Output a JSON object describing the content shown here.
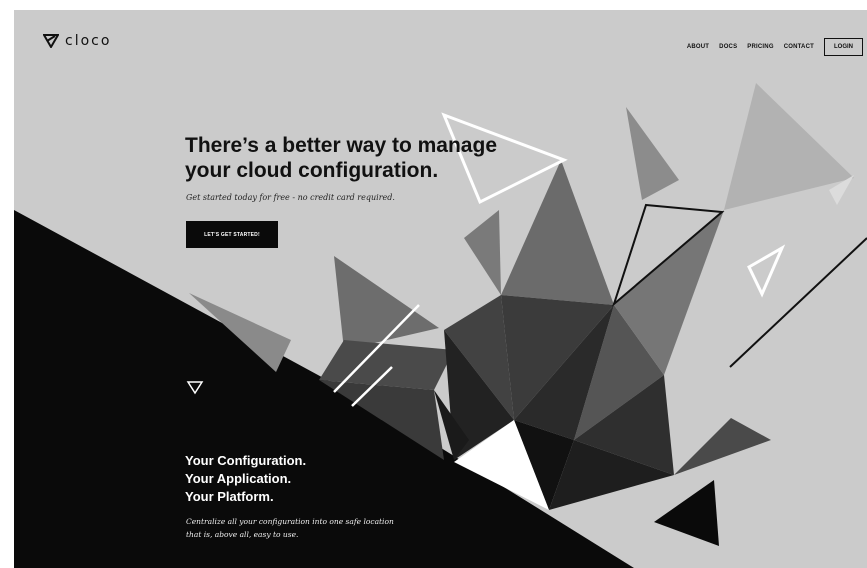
{
  "brand": {
    "name": "cloco",
    "icon": "cloco-logo-icon"
  },
  "nav": {
    "items": [
      "ABOUT",
      "DOCS",
      "PRICING",
      "CONTACT"
    ],
    "login": "LOGIN"
  },
  "hero": {
    "headline": "There’s a better way to manage your cloud configuration.",
    "tagline": "Get started today for free - no credit card required.",
    "cta": "LET’S GET STARTED!"
  },
  "features": {
    "lines": [
      "Your Configuration.",
      "Your Application.",
      "Your Platform."
    ],
    "description": "Centralize all your configuration into one safe location that is, above all, easy to use."
  },
  "colors": {
    "background": "#cbcbcb",
    "dark": "#0a0a0a",
    "text": "#111111"
  }
}
